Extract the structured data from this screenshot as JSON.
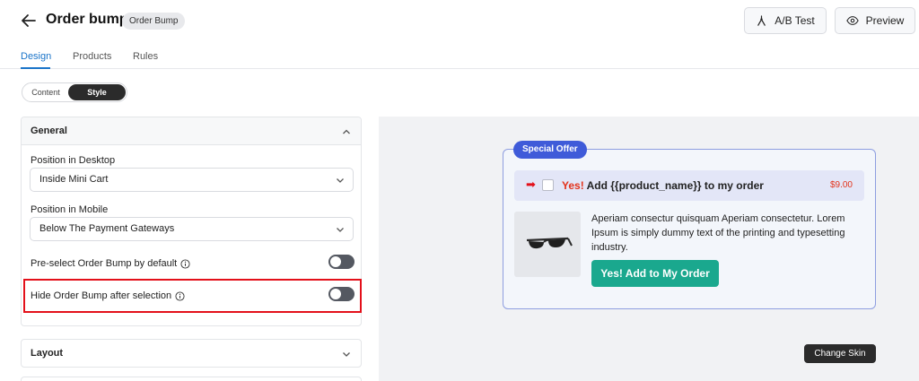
{
  "header": {
    "title": "Order bump",
    "badge": "Order Bump",
    "ab_test_label": "A/B Test",
    "preview_label": "Preview"
  },
  "tabs": [
    {
      "label": "Design",
      "active": true
    },
    {
      "label": "Products",
      "active": false
    },
    {
      "label": "Rules",
      "active": false
    }
  ],
  "mode_toggle": {
    "content_label": "Content",
    "style_label": "Style",
    "selected": "Style"
  },
  "general_panel": {
    "title": "General",
    "position_desktop_label": "Position in Desktop",
    "position_desktop_value": "Inside Mini Cart",
    "position_mobile_label": "Position in Mobile",
    "position_mobile_value": "Below The Payment Gateways",
    "preselect_label": "Pre-select Order Bump by default",
    "preselect_on": false,
    "hide_after_label": "Hide Order Bump after selection",
    "hide_after_on": false
  },
  "layout_panel": {
    "title": "Layout"
  },
  "preview": {
    "special_offer": "Special Offer",
    "offer_yes": "Yes!",
    "offer_text": "Add {{product_name}} to my order",
    "offer_price": "$9.00",
    "description": "Aperiam consectur quisquam Aperiam consectetur. Lorem Ipsum is simply dummy text of the printing and typesetting industry.",
    "cta_label": "Yes! Add to My Order",
    "change_skin_label": "Change Skin"
  },
  "colors": {
    "accent_blue": "#1a74c9",
    "offer_badge": "#3f5bd9",
    "cta_green": "#1aa88e",
    "highlight_red": "#e3101a"
  }
}
